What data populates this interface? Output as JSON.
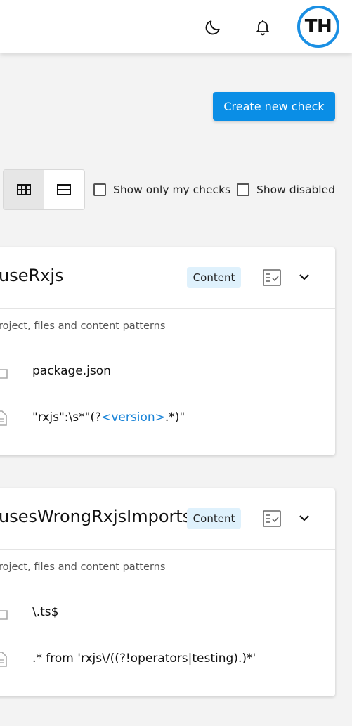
{
  "header": {
    "avatar_initials": "TH",
    "theme_icon": "moon-icon",
    "notifications_icon": "bell-icon",
    "accent_color": "#1a8fe3"
  },
  "toolbar": {
    "create_label": "Create new check",
    "view_modes": [
      "grid-view-icon",
      "list-view-icon"
    ],
    "active_view": "grid",
    "filters": [
      {
        "label": "Show only my checks",
        "checked": false
      },
      {
        "label": "Show disabled",
        "checked": false
      }
    ]
  },
  "checks": [
    {
      "title": "useRxjs",
      "badge": "Content",
      "description": "roject, files and content patterns",
      "file_pattern": "package.json",
      "content_prefix": "\"rxjs\":\\s*\"(?",
      "content_highlight": "<version>",
      "content_suffix": ".*)\""
    },
    {
      "title": "usesWrongRxjsImports",
      "badge": "Content",
      "description": "roject, files and content patterns",
      "file_pattern": "\\.ts$",
      "content_prefix": ".* from 'rxjs\\/((?!operators|testing).)*'",
      "content_highlight": "",
      "content_suffix": ""
    }
  ]
}
